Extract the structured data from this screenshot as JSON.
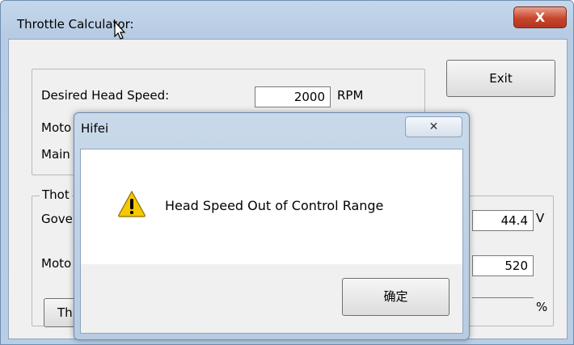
{
  "window": {
    "title": "Throttle Calculator:",
    "close_glyph": "X"
  },
  "main": {
    "exit_button": "Exit",
    "desired_head_speed_label": "Desired Head Speed:",
    "desired_head_speed_value": "2000",
    "desired_head_speed_unit": "RPM",
    "motor_label_partial": "Moto",
    "main_label_partial": "Main",
    "throttle_group_caption_partial": "Thot",
    "governor_label_partial": "Gove",
    "motor_label2_partial": "Moto",
    "voltage_value": "44.4",
    "voltage_unit": "V",
    "kv_value": "520",
    "percent_unit": "%",
    "throttle_button_partial": "Th"
  },
  "dialog": {
    "title": "Hifei",
    "close_glyph": "✕",
    "message": "Head Speed Out of Control Range",
    "ok_button": "确定",
    "icon": "warning-icon"
  },
  "colors": {
    "warning_yellow": "#f5c800",
    "close_red": "#c7452b"
  }
}
